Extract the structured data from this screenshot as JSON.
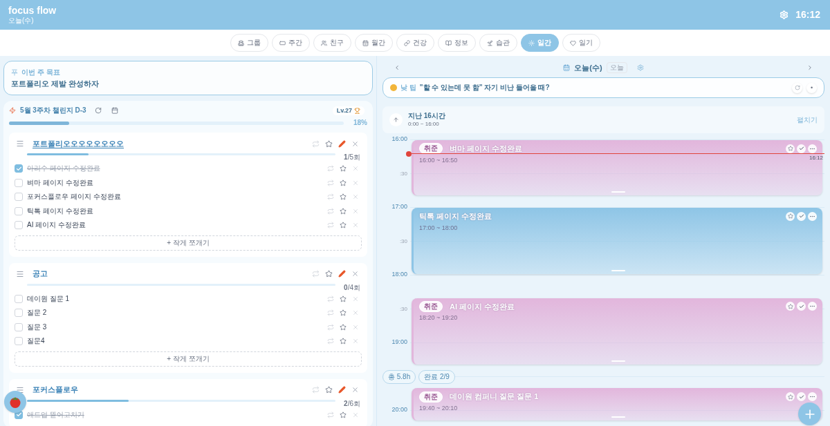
{
  "header": {
    "title": "focus flow",
    "subtitle": "오늘(수)",
    "clock": "16:12"
  },
  "nav_tabs": [
    {
      "label": "그룹",
      "selected": false
    },
    {
      "label": "주간",
      "selected": false
    },
    {
      "label": "친구",
      "selected": false
    },
    {
      "label": "월간",
      "selected": false
    },
    {
      "label": "건강",
      "selected": false
    },
    {
      "label": "정보",
      "selected": false
    },
    {
      "label": "습관",
      "selected": false
    },
    {
      "label": "일간",
      "selected": true
    },
    {
      "label": "일기",
      "selected": false
    }
  ],
  "weekly_goal": {
    "marker": "푸",
    "label": "이번 주 목표",
    "text": "포트폴리오 제발 완성하자"
  },
  "challenge": {
    "title": "5월 3주차 챌린지 D-3",
    "level_badge": "Lv.27",
    "level": 0.18,
    "percent": "18%"
  },
  "projects": [
    {
      "title": "포트폴리오오오오오오오오",
      "level": 0.2,
      "count": "**1**/5회",
      "add_button": "+ 작게 쪼개기",
      "tasks": [
        {
          "text": "아리수 페이지 수정완료",
          "checked": true
        },
        {
          "text": "벼마 페이지 수정완료",
          "checked": false
        },
        {
          "text": "포커스플로우 페이지 수정완료",
          "checked": false
        },
        {
          "text": "틱톡 페이지 수정완료",
          "checked": false
        },
        {
          "text": "AI 페이지 수정완료",
          "checked": false
        }
      ]
    },
    {
      "title": "공고",
      "level": 0,
      "count": "**0**/4회",
      "add_button": "+ 작게 쪼개기",
      "tasks": [
        {
          "text": "데이원 질문 1",
          "checked": false
        },
        {
          "text": "질문 2",
          "checked": false
        },
        {
          "text": "질문 3",
          "checked": false
        },
        {
          "text": "질문4",
          "checked": false
        }
      ]
    },
    {
      "title": "포커스플로우",
      "level": 0.33,
      "count": "**2**/6회",
      "tasks": [
        {
          "text": "애드업 뜯어고치기",
          "checked": true
        }
      ]
    }
  ],
  "day_view": {
    "date": "오늘(수)",
    "today_button": "오늘",
    "tip": {
      "label": "낮 팁",
      "text": "\"할 수 있는데 못 함\" 자기 비난 들어올 때?",
      "dot": "•"
    },
    "past": {
      "title": "지난 16시간",
      "range": "0:00 ~ 16:00",
      "expand": "펼치기"
    },
    "timeline_rows": [
      {
        "kind": "time",
        "label": "16:00"
      },
      {
        "kind": "half",
        "label": ":30"
      },
      {
        "kind": "time",
        "label": "17:00"
      },
      {
        "kind": "half",
        "label": ":30"
      },
      {
        "kind": "time",
        "label": "18:00"
      },
      {
        "kind": "half",
        "label": ":30"
      },
      {
        "kind": "time",
        "label": "19:00"
      },
      {
        "kind": "summary",
        "chips": [
          "총 5.8h",
          "완료 2/9"
        ]
      },
      {
        "kind": "time",
        "label": "20:00"
      }
    ],
    "now": "16:12",
    "events": [
      {
        "tag": "취준",
        "title": "벼마 페이지 수정완료",
        "time": "16:00 ~ 16:50",
        "color": "#e2b6dc"
      },
      {
        "title": "틱톡 페이지 수정완료",
        "time": "17:00 ~ 18:00",
        "color": "#8ec5e6"
      },
      {
        "tag": "취준",
        "title": "AI 페이지 수정완료",
        "time": "18:20 ~ 19:20",
        "color": "#e2b6dc"
      },
      {
        "tag": "취준",
        "title": "데이원 컴퍼니 질문 질문 1",
        "time": "19:40 ~ 20:10",
        "color": "#e2b6dc"
      }
    ]
  }
}
